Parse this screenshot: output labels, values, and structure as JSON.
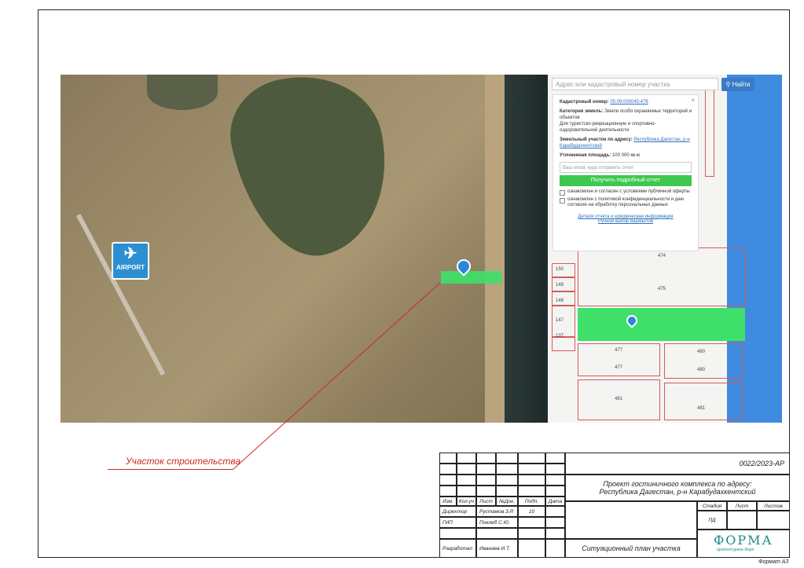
{
  "map": {
    "airport_label": "AIRPORT",
    "site_label": "Участок строительства"
  },
  "cadastre": {
    "search_placeholder": "Адрес или кадастровый номер участка",
    "search_button": "Найти",
    "parcel_numbers": [
      "474",
      "475",
      "150",
      "149",
      "148",
      "147",
      "137",
      "477",
      "477",
      "480",
      "480",
      "481",
      "481"
    ],
    "popup": {
      "cad_num_label": "Кадастровый номер:",
      "cad_num_value": "05:09:000045:476",
      "category_label": "Категория земель:",
      "category_value": "Земли особо охраняемых территорий и объектов",
      "use_value": "Для туристско-рекреационную и спортивно-оздоровительной деятельности",
      "address_label": "Земельный участок по адресу:",
      "address_value": "Республика Дагестан, р-н Карабудахкентский",
      "area_label": "Уточненная площадь:",
      "area_value": "100 000 кв.м",
      "email_placeholder": "Ваш email, куда отправить отчет",
      "get_report": "Получить подробный отчет",
      "check1": "ознакомлен и согласен с условиями публичной оферты",
      "check2": "ознакомлен с политикой конфиденциальности и даю согласие на обработку персональных данных",
      "details_link": "Детали отчета и юридическая информация",
      "manual_link": "Ручной выбор вариантов"
    }
  },
  "stamp": {
    "code": "0022/2023-АР",
    "project_title": "Проект гостиничного комплекса по адресу: Республика Дагестан, р-н Карабудахкентский",
    "cols": [
      "Изм.",
      "Кол.уч",
      "Лист",
      "№Док.",
      "Подп.",
      "Дата"
    ],
    "roles": [
      {
        "role": "Директор",
        "name": "Рустамов З.Р."
      },
      {
        "role": "ГИП",
        "name": "Поклеб С.Ю."
      },
      {
        "role": "Разработал",
        "name": "Иванаев И.Т."
      }
    ],
    "stage_label": "Стадия",
    "sheet_label": "Лист",
    "sheets_label": "Листов",
    "stage_value": "ПД",
    "sheet_title": "Ситуационный план участка",
    "signature_date": "10",
    "logo": "ФОРМА",
    "logo_sub": "архитектурное бюро"
  },
  "format_label": "Формат А3"
}
